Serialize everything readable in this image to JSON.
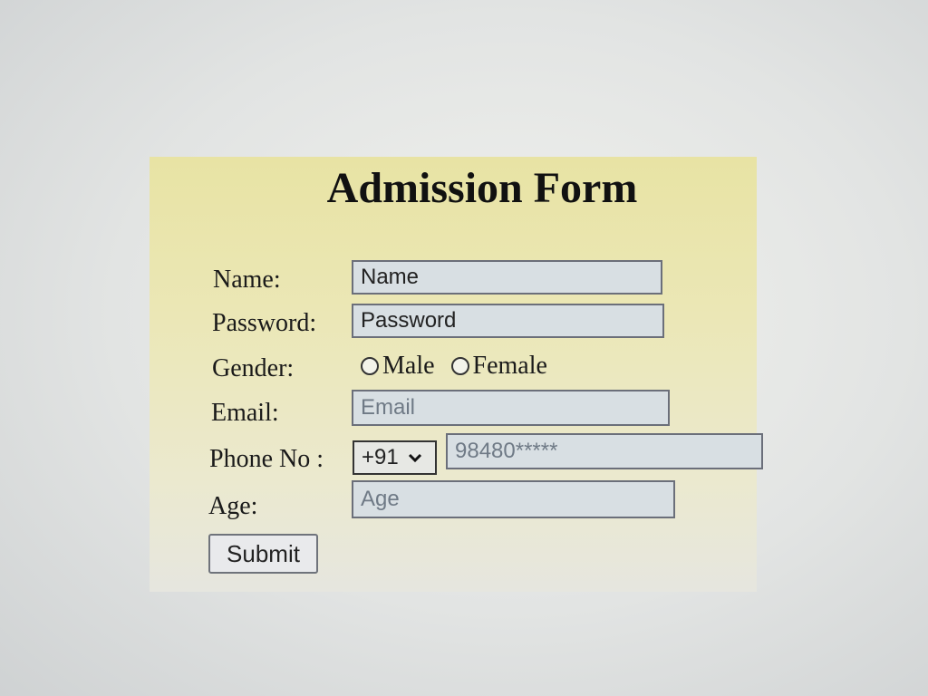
{
  "form": {
    "title": "Admission Form",
    "labels": {
      "name": "Name:",
      "password": "Password:",
      "gender": "Gender:",
      "email": "Email:",
      "phone": "Phone No :",
      "age": "Age:"
    },
    "fields": {
      "name": {
        "value": "Name",
        "placeholder": "Name"
      },
      "password": {
        "value": "Password",
        "placeholder": "Password"
      },
      "email": {
        "placeholder": "Email"
      },
      "phone": {
        "placeholder": "98480*****"
      },
      "age": {
        "placeholder": "Age"
      }
    },
    "gender_options": [
      "Male",
      "Female"
    ],
    "country_code": "+91",
    "submit_label": "Submit"
  },
  "colors": {
    "panel_background": "#e8e3a4",
    "input_background": "#d8dfe3",
    "text": "#1a1a1a"
  },
  "icons": [
    "radio-unchecked-icon",
    "chevron-down-icon"
  ]
}
